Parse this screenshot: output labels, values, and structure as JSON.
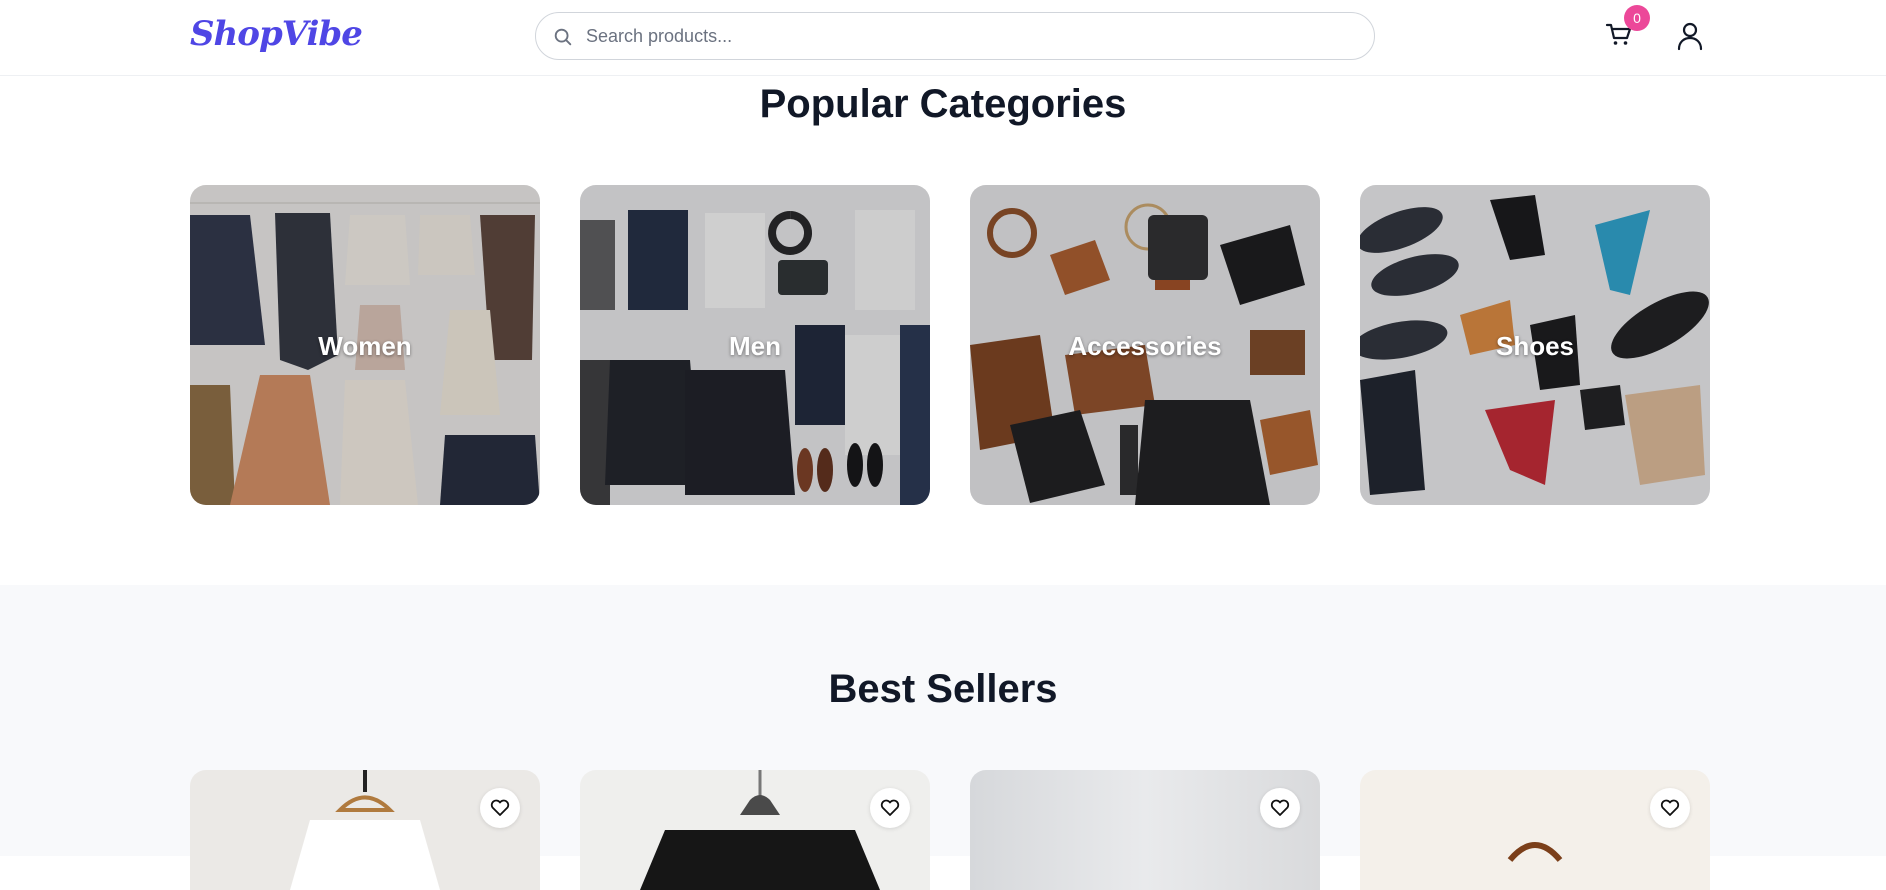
{
  "header": {
    "logo": "ShopVibe",
    "search_placeholder": "Search products...",
    "cart_count": "0"
  },
  "categories": {
    "title": "Popular Categories",
    "items": [
      {
        "label": "Women"
      },
      {
        "label": "Men"
      },
      {
        "label": "Accessories"
      },
      {
        "label": "Shoes"
      }
    ]
  },
  "best_sellers": {
    "title": "Best Sellers"
  },
  "colors": {
    "brand": "#4f46e5",
    "badge": "#ec4899"
  }
}
